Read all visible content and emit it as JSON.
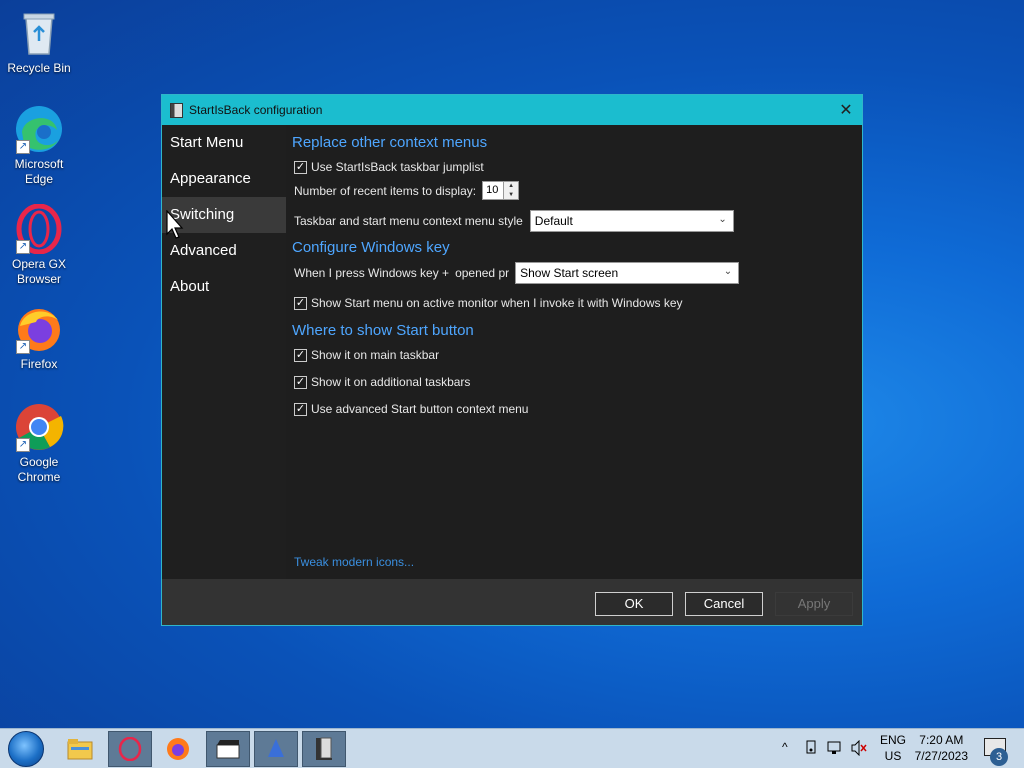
{
  "desktop": {
    "icons": [
      {
        "label": "Recycle Bin"
      },
      {
        "label": "Microsoft Edge"
      },
      {
        "label": "Opera GX Browser"
      },
      {
        "label": "Firefox"
      },
      {
        "label": "Google Chrome"
      }
    ]
  },
  "window": {
    "title": "StartIsBack configuration",
    "close_glyph": "✕",
    "sidebar": [
      {
        "label": "Start Menu"
      },
      {
        "label": "Appearance"
      },
      {
        "label": "Switching",
        "active": true
      },
      {
        "label": "Advanced"
      },
      {
        "label": "About"
      }
    ],
    "sections": {
      "context_menus": {
        "title": "Replace other context menus",
        "jumplist": {
          "label": "Use StartIsBack taskbar jumplist",
          "checked": true
        },
        "recent_items": {
          "label": "Number of recent items to display:",
          "value": "10"
        },
        "context_style": {
          "label": "Taskbar and start menu context menu style",
          "selected": "Default"
        }
      },
      "windows_key": {
        "title": "Configure Windows key",
        "press_label": "When I press Windows key + ",
        "press_label_tail": "opened pr",
        "press_selected": "Show Start screen",
        "active_monitor": {
          "label": "Show Start menu on active monitor when I invoke it with Windows key",
          "checked": true
        }
      },
      "start_button": {
        "title": "Where to show Start button",
        "main_taskbar": {
          "label": "Show it on main taskbar",
          "checked": true
        },
        "additional_taskbars": {
          "label": "Show it on additional taskbars",
          "checked": true
        },
        "advanced_context": {
          "label": "Use advanced Start button context menu",
          "checked": true
        }
      }
    },
    "tweak_link": "Tweak modern icons...",
    "buttons": {
      "ok": "OK",
      "cancel": "Cancel",
      "apply": "Apply"
    }
  },
  "taskbar": {
    "lang_top": "ENG",
    "lang_bottom": "US",
    "time": "7:20 AM",
    "date": "7/27/2023",
    "notifications_count": "3",
    "tray_chevron": "^"
  }
}
